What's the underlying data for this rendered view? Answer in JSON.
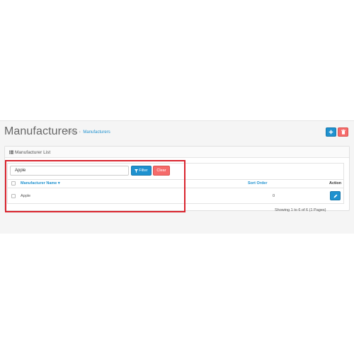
{
  "header": {
    "title": "Manufacturers",
    "breadcrumb": [
      {
        "label": "Home"
      },
      {
        "label": "Manufacturers"
      }
    ],
    "breadcrumb_separator": "›",
    "add_button_icon": "plus-icon",
    "delete_button_icon": "trash-icon"
  },
  "panel": {
    "title": "Manufacturer List",
    "title_icon": "list-icon"
  },
  "filter": {
    "value": "Apple",
    "filter_label": "Filter",
    "filter_icon": "funnel-icon",
    "clear_label": "Clear"
  },
  "table": {
    "columns": {
      "name": "Manufacturer Name",
      "sort_indicator": "▾",
      "sort_order": "Sort Order",
      "action": "Action"
    },
    "rows": [
      {
        "name": "Apple",
        "sort_order": "0",
        "action_icon": "pencil-icon"
      }
    ]
  },
  "pagination": {
    "info": "Showing 1 to 6 of 6 (1 Pages)"
  },
  "colors": {
    "primary": "#1e91cf",
    "danger": "#f56b6b",
    "highlight": "#d9232d"
  }
}
